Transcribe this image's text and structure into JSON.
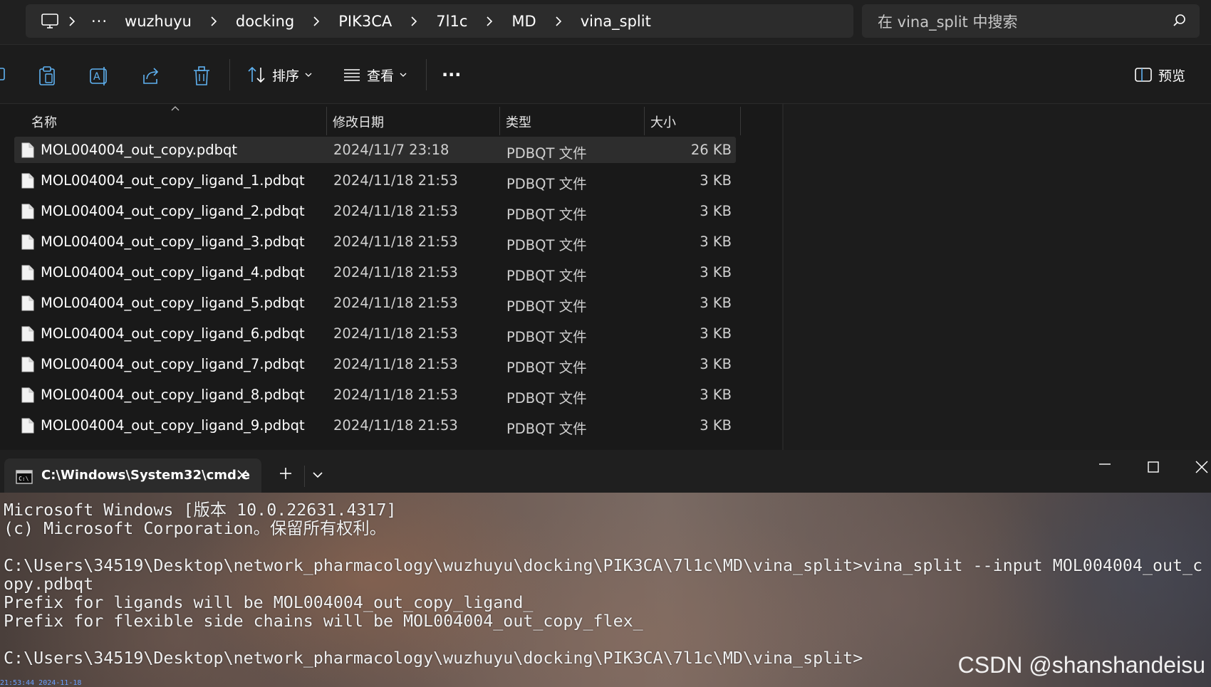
{
  "breadcrumb": {
    "overflow": "···",
    "items": [
      "wuzhuyu",
      "docking",
      "PIK3CA",
      "7l1c",
      "MD",
      "vina_split"
    ]
  },
  "search": {
    "placeholder": "在 vina_split 中搜索"
  },
  "toolbar": {
    "sort_label": "排序",
    "view_label": "查看",
    "more_label": "···",
    "preview_label": "预览"
  },
  "columns": {
    "name": "名称",
    "date": "修改日期",
    "type": "类型",
    "size": "大小"
  },
  "files": [
    {
      "name": "MOL004004_out_copy.pdbqt",
      "date": "2024/11/7 23:18",
      "type": "PDBQT 文件",
      "size": "26 KB",
      "selected": true
    },
    {
      "name": "MOL004004_out_copy_ligand_1.pdbqt",
      "date": "2024/11/18 21:53",
      "type": "PDBQT 文件",
      "size": "3 KB"
    },
    {
      "name": "MOL004004_out_copy_ligand_2.pdbqt",
      "date": "2024/11/18 21:53",
      "type": "PDBQT 文件",
      "size": "3 KB"
    },
    {
      "name": "MOL004004_out_copy_ligand_3.pdbqt",
      "date": "2024/11/18 21:53",
      "type": "PDBQT 文件",
      "size": "3 KB"
    },
    {
      "name": "MOL004004_out_copy_ligand_4.pdbqt",
      "date": "2024/11/18 21:53",
      "type": "PDBQT 文件",
      "size": "3 KB"
    },
    {
      "name": "MOL004004_out_copy_ligand_5.pdbqt",
      "date": "2024/11/18 21:53",
      "type": "PDBQT 文件",
      "size": "3 KB"
    },
    {
      "name": "MOL004004_out_copy_ligand_6.pdbqt",
      "date": "2024/11/18 21:53",
      "type": "PDBQT 文件",
      "size": "3 KB"
    },
    {
      "name": "MOL004004_out_copy_ligand_7.pdbqt",
      "date": "2024/11/18 21:53",
      "type": "PDBQT 文件",
      "size": "3 KB"
    },
    {
      "name": "MOL004004_out_copy_ligand_8.pdbqt",
      "date": "2024/11/18 21:53",
      "type": "PDBQT 文件",
      "size": "3 KB"
    },
    {
      "name": "MOL004004_out_copy_ligand_9.pdbqt",
      "date": "2024/11/18 21:53",
      "type": "PDBQT 文件",
      "size": "3 KB"
    }
  ],
  "terminal": {
    "tab_title": "C:\\Windows\\System32\\cmd.e",
    "lines": [
      "Microsoft Windows [版本 10.0.22631.4317]",
      "(c) Microsoft Corporation。保留所有权利。",
      "",
      "C:\\Users\\34519\\Desktop\\network_pharmacology\\wuzhuyu\\docking\\PIK3CA\\7l1c\\MD\\vina_split>vina_split --input MOL004004_out_c",
      "opy.pdbqt",
      "Prefix for ligands will be MOL004004_out_copy_ligand_",
      "Prefix for flexible side chains will be MOL004004_out_copy_flex_",
      "",
      "C:\\Users\\34519\\Desktop\\network_pharmacology\\wuzhuyu\\docking\\PIK3CA\\7l1c\\MD\\vina_split>"
    ],
    "watermark": "CSDN @shanshandeisu",
    "timestamp": "21:53:44 2024-11-18"
  }
}
